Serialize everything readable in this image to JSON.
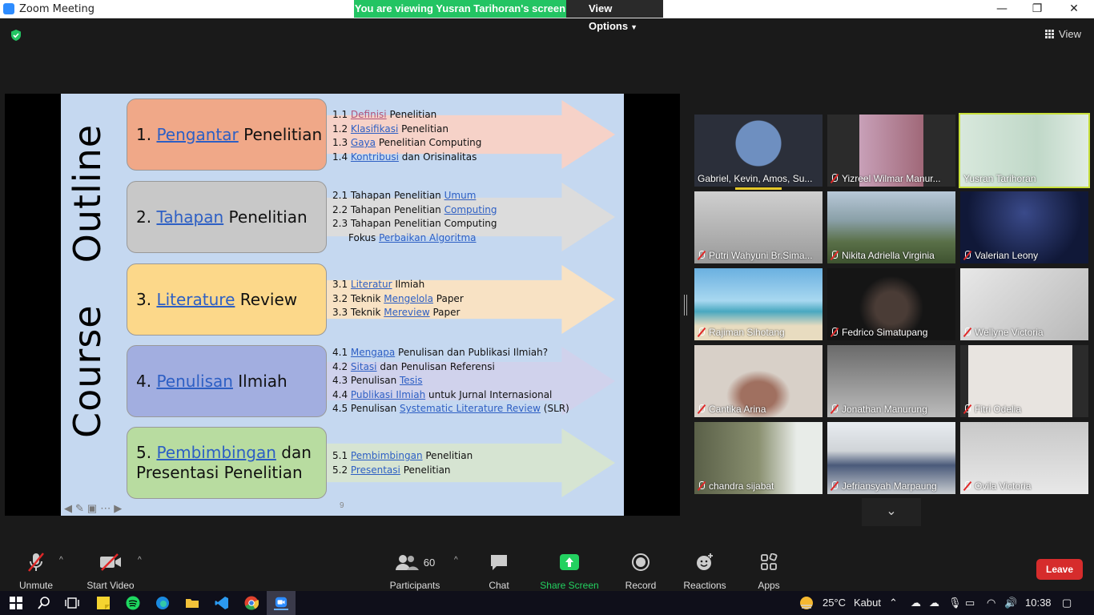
{
  "window": {
    "title": "Zoom Meeting",
    "minimize": "—",
    "restore": "❐",
    "close": "✕"
  },
  "banner": {
    "viewing": "You are viewing Yusran Tarihoran's screen",
    "view_options": "View Options"
  },
  "view_button": "View",
  "slide": {
    "vertical_title_1": "Course",
    "vertical_title_2": "Outline",
    "page_number": "9",
    "sections": [
      {
        "num": "1.",
        "title_link": "Pengantar",
        "title_rest": "Penelitian",
        "items": [
          {
            "pre": "1.1 ",
            "link": "Definisi",
            "post": " Penelitian"
          },
          {
            "pre": "1.2 ",
            "link": "Klasifikasi",
            "post": " Penelitian"
          },
          {
            "pre": "1.3 ",
            "link": "Gaya",
            "post": " Penelitian Computing"
          },
          {
            "pre": "1.4 ",
            "link": "Kontribusi",
            "post": " dan Orisinalitas"
          }
        ]
      },
      {
        "num": "2.",
        "title_link": "Tahapan",
        "title_rest": "Penelitian",
        "items": [
          {
            "pre": "2.1 Tahapan Penelitian ",
            "link": "Umum",
            "post": ""
          },
          {
            "pre": "2.2 Tahapan Penelitian ",
            "link": "Computing",
            "post": ""
          },
          {
            "pre": "2.3 Tahapan Penelitian Computing",
            "link": "",
            "post": ""
          },
          {
            "pre": "Fokus ",
            "link": "Perbaikan Algoritma",
            "post": ""
          }
        ]
      },
      {
        "num": "3.",
        "title_link": "Literature",
        "title_rest": "Review",
        "items": [
          {
            "pre": "3.1 ",
            "link": "Literatur",
            "post": " Ilmiah"
          },
          {
            "pre": "3.2 Teknik ",
            "link": "Mengelola",
            "post": " Paper"
          },
          {
            "pre": "3.3 Teknik ",
            "link": "Mereview",
            "post": " Paper"
          }
        ]
      },
      {
        "num": "4.",
        "title_link": "Penulisan",
        "title_rest": "Ilmiah",
        "items": [
          {
            "pre": "4.1 ",
            "link": "Mengapa",
            "post": " Penulisan dan Publikasi Ilmiah?"
          },
          {
            "pre": "4.2 ",
            "link": "Sitasi",
            "post": " dan Penulisan Referensi"
          },
          {
            "pre": "4.3 Penulisan ",
            "link": "Tesis",
            "post": ""
          },
          {
            "pre": "4.4 ",
            "link": "Publikasi Ilmiah",
            "post": " untuk Jurnal Internasional"
          },
          {
            "pre": "4.5 Penulisan ",
            "link": "Systematic Literature Review",
            "post": " (SLR)"
          }
        ]
      },
      {
        "num": "5.",
        "title_link": "Pembimbingan",
        "title_rest": "dan",
        "title_line2": "Presentasi Penelitian",
        "items": [
          {
            "pre": "5.1 ",
            "link": "Pembimbingan",
            "post": " Penelitian"
          },
          {
            "pre": "5.2 ",
            "link": "Presentasi",
            "post": " Penelitian"
          }
        ]
      }
    ]
  },
  "participants_tiles": [
    {
      "name": "Gabriel, Kevin, Amos, Su...",
      "muted": false
    },
    {
      "name": "Yizreel Wilmar Manur...",
      "muted": true
    },
    {
      "name": "Yusran Tarihoran",
      "muted": false
    },
    {
      "name": "Putri Wahyuni Br.Sima...",
      "muted": true
    },
    {
      "name": "Nikita Adriella Virginia",
      "muted": true
    },
    {
      "name": "Valerian Leony",
      "muted": true
    },
    {
      "name": "Rajiman Sihotang",
      "muted": true
    },
    {
      "name": "Fedrico Simatupang",
      "muted": true
    },
    {
      "name": "Wellyne Victoria",
      "muted": true
    },
    {
      "name": "Cantika Arina",
      "muted": true
    },
    {
      "name": "Jonathan Manurung",
      "muted": true
    },
    {
      "name": "Fitri Odelia",
      "muted": true
    },
    {
      "name": "chandra sijabat",
      "muted": true
    },
    {
      "name": "Jefriansyah Marpaung",
      "muted": true
    },
    {
      "name": "Ovila Victoria",
      "muted": true
    }
  ],
  "toolbar": {
    "unmute": "Unmute",
    "start_video": "Start Video",
    "participants": "Participants",
    "participants_count": "60",
    "chat": "Chat",
    "share_screen": "Share Screen",
    "record": "Record",
    "reactions": "Reactions",
    "apps": "Apps",
    "leave": "Leave"
  },
  "taskbar": {
    "temperature": "25°C",
    "weather": "Kabut",
    "time": "10:38"
  }
}
